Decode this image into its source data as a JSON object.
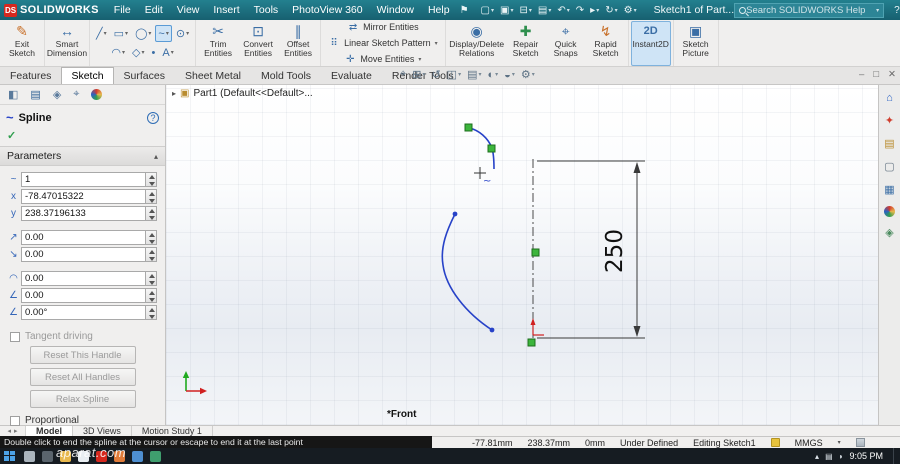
{
  "titlebar": {
    "brand": "SOLIDWORKS",
    "brand_mark": "DS",
    "menus": [
      "File",
      "Edit",
      "View",
      "Insert",
      "Tools",
      "PhotoView 360",
      "Window",
      "Help"
    ],
    "doc_title": "Sketch1 of Part...",
    "search_placeholder": "Search SOLIDWORKS Help"
  },
  "ribbon": {
    "buttons": {
      "exit_sketch": "Exit Sketch",
      "smart_dimension": "Smart Dimension",
      "trim_entities": "Trim Entities",
      "convert_entities": "Convert Entities",
      "offset_entities": "Offset Entities",
      "mirror_entities": "Mirror Entities",
      "linear_sketch_pattern": "Linear Sketch Pattern",
      "move_entities": "Move Entities",
      "display_delete_relations": "Display/Delete Relations",
      "repair_sketch": "Repair Sketch",
      "quick_snaps": "Quick Snaps",
      "rapid_sketch": "Rapid Sketch",
      "instant2d": "Instant2D",
      "sketch_picture": "Sketch Picture"
    }
  },
  "command_tabs": [
    "Features",
    "Sketch",
    "Surfaces",
    "Sheet Metal",
    "Mold Tools",
    "Evaluate",
    "Render Tools"
  ],
  "property_panel": {
    "title": "Spline",
    "parameters_header": "Parameters",
    "fields": {
      "spline_point_number": "1",
      "x_coordinate": "-78.47015322",
      "y_coordinate": "238.37196133",
      "tangent_weighting_1": "0.00",
      "tangent_weighting_2": "0.00",
      "tangent_radial_direction": "0.00",
      "tangent_polar_direction": "0.00",
      "tangent_driving_angle": "0.00°"
    },
    "tangent_driving_label": "Tangent driving",
    "reset_this_handle": "Reset This Handle",
    "reset_all_handles": "Reset All Handles",
    "relax_spline": "Relax Spline",
    "proportional_label": "Proportional"
  },
  "graphics": {
    "tree_item": "Part1 (Default<<Default>...",
    "dimension_value": "250",
    "plane_label": "*Front"
  },
  "document_tabs": [
    "Model",
    "3D Views",
    "Motion Study 1"
  ],
  "statusbar": {
    "message": "Double click to end the spline at the cursor or escape to end it at the last point",
    "x": "-77.81mm",
    "y": "238.37mm",
    "z": "0mm",
    "definition_status": "Under Defined",
    "editing_status": "Editing Sketch1",
    "units": "MMGS"
  },
  "taskbar": {
    "time": "9:05 PM"
  },
  "watermark": "aparat.com",
  "icons": {
    "caret_down": "▾",
    "pin": "⚑",
    "new_doc": "▢",
    "open_doc": "▣",
    "save_doc": "⊟",
    "print_doc": "▤",
    "undo": "↶",
    "redo": "↷",
    "select_arrow": "▸",
    "rebuild": "↻",
    "options_gear": "⚙",
    "help": "?",
    "minimize": "–",
    "restore": "□",
    "close": "✕",
    "exit_sketch": "✎",
    "smart_dimension": "↔",
    "line": "╱",
    "rectangle": "▭",
    "circle": "◯",
    "arc": "◠",
    "polygon": "◇",
    "spline": "~",
    "ellipse": "⊙",
    "point": "•",
    "text_tool": "A",
    "trim": "✂",
    "convert": "⊡",
    "offset": "∥",
    "mirror": "⇄",
    "pattern": "⠿",
    "move": "✛",
    "relations": "◉",
    "repair": "✚",
    "snaps": "⌖",
    "rapid": "↯",
    "instant2d": "2D",
    "picture": "▣",
    "check": "✓",
    "chevron_up": "▴",
    "expand": "▸",
    "part": "▣",
    "home": "⌂",
    "resources": "✦",
    "library": "▤",
    "folder": "▢",
    "grid": "▦",
    "gem": "◈",
    "layers": "◧",
    "zoom_fit": "⌖",
    "zoom_area": "⊞",
    "prev_view": "↺",
    "section": "◫",
    "orientation": "▤",
    "display_style": "◐",
    "hide_show": "◒",
    "scene": "⚙",
    "tray_up": "▴",
    "tray_net": "▤",
    "tray_vol": "◗",
    "spline_small": "~",
    "x_small": "x",
    "y_small": "y",
    "tangent1": "↗",
    "tangent2": "↘",
    "radial": "◠",
    "polar": "∠",
    "angle": "∠"
  }
}
